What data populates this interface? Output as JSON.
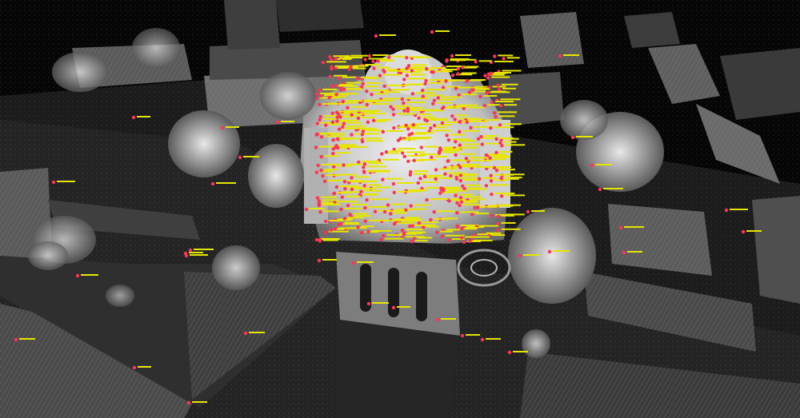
{
  "scene": {
    "subject": "point-cloud-survey-aerial",
    "colors": {
      "background": "#020202",
      "ground": "#1f1f1f",
      "roof": "#555555",
      "wall": "#8a8a8a",
      "facade_bright": "#e0e0e0",
      "tree": "#d2d2d2",
      "marker": "#ff3355",
      "label": "#e6e600"
    },
    "icons": {
      "marker": "survey-target-marker-icon"
    }
  }
}
